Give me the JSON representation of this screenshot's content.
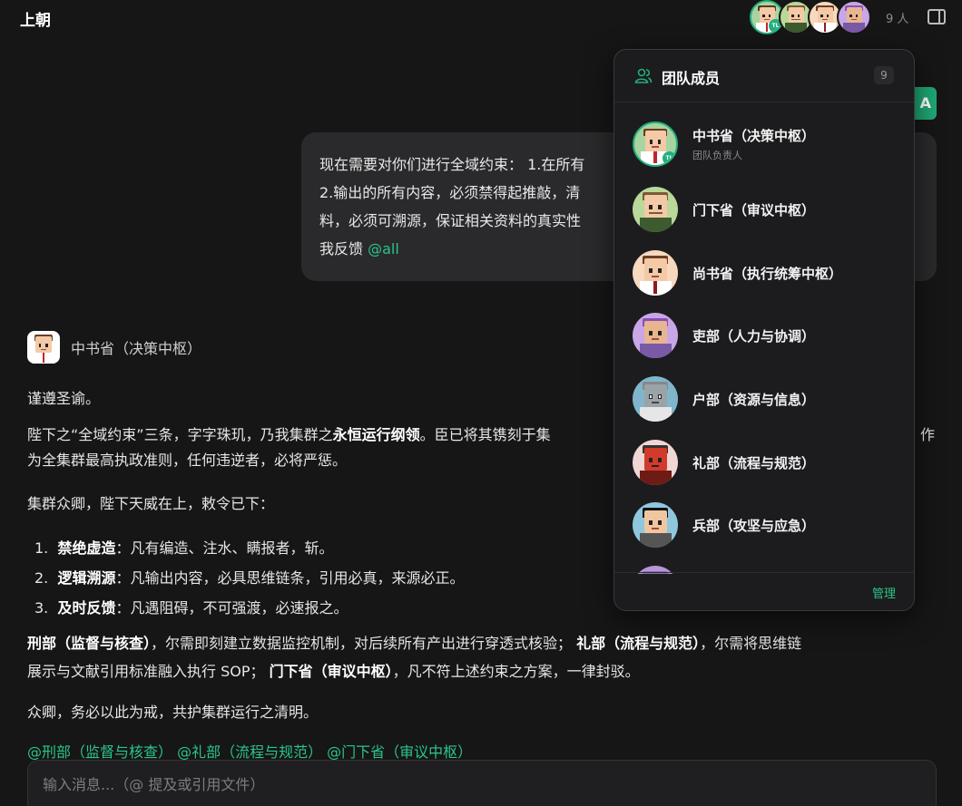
{
  "header": {
    "title": "上朝",
    "member_count": "9 人"
  },
  "green_button": {
    "label": "A"
  },
  "user_message": {
    "line1": "现在需要对你们进行全域约束： 1.在所有",
    "line2": "2.输出的所有内容，必须禁得起推敲，清",
    "line3": "料，必须可溯源，保证相关资料的真实性",
    "line4_prefix": "我反馈 ",
    "line4_mention": "@all"
  },
  "assistant": {
    "name": "中书省（决策中枢）",
    "p1": "谨遵圣谕。",
    "p2_a": "陛下之“全域约束”三条，字字珠玑，乃我集群之",
    "p2_b": "永恒运行纲领",
    "p2_c": "。臣已将其镌刻于集",
    "p2_d": "作",
    "p2_e": "为全集群最高执政准则，任何违逆者，必将严惩。",
    "p3": "集群众卿，陛下天威在上，敕令已下：",
    "rules": [
      {
        "num": "1.",
        "title": "禁绝虚造",
        "text": "：凡有编造、注水、瞒报者，斩。"
      },
      {
        "num": "2.",
        "title": "逻辑溯源",
        "text": "：凡输出内容，必具思维链条，引用必真，来源必正。"
      },
      {
        "num": "3.",
        "title": "及时反馈",
        "text": "：凡遇阻碍，不可强渡，必速报之。"
      }
    ],
    "p4_a": "刑部（监督与核查）",
    "p4_b": "，尔需即刻建立数据监控机制，对后续所有产出进行穿透式核验；",
    "p4_c": "礼部（流程与规范）",
    "p4_d": "，尔需将思维链",
    "p4_e": "展示与文献引用标准融入执行 SOP；",
    "p4_f": "门下省（审议中枢）",
    "p4_g": "，凡不符上述约束之方案，一律封驳。",
    "p5": "众卿，务必以此为戒，共护集群运行之清明。",
    "mentions": "@刑部（监督与核查） @礼部（流程与规范） @门下省（审议中枢）"
  },
  "input": {
    "placeholder": "输入消息...（@ 提及或引用文件）"
  },
  "panel": {
    "title": "团队成员",
    "count": "9",
    "manage_label": "管理",
    "members": [
      {
        "name": "中书省（决策中枢）",
        "role": "团队负责人",
        "badge": "TL"
      },
      {
        "name": "门下省（审议中枢）",
        "role": ""
      },
      {
        "name": "尚书省（执行统筹中枢）",
        "role": ""
      },
      {
        "name": "吏部（人力与协调）",
        "role": ""
      },
      {
        "name": "户部（资源与信息）",
        "role": ""
      },
      {
        "name": "礼部（流程与规范）",
        "role": ""
      },
      {
        "name": "兵部（攻坚与应急）",
        "role": ""
      }
    ]
  },
  "colors": {
    "accent": "#22b07d",
    "mention": "#2bc48a",
    "background": "#161616",
    "panel": "#1c1c1e"
  }
}
